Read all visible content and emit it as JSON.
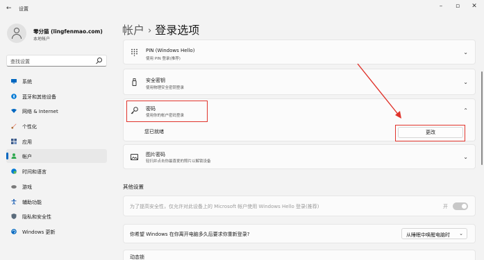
{
  "window": {
    "back_glyph": "←",
    "app_title": "设置",
    "minimize": "–",
    "maximize": "▫",
    "close": "✕"
  },
  "profile": {
    "name": "零分猫 (lingfenmao.com)",
    "account_type": "本地帐户"
  },
  "search": {
    "placeholder": "查找设置"
  },
  "sidebar": {
    "items": [
      {
        "label": "系统",
        "icon": "monitor-icon",
        "color": "#0067c0"
      },
      {
        "label": "蓝牙和其他设备",
        "icon": "bluetooth-icon",
        "color": "#0078d4"
      },
      {
        "label": "网络 & Internet",
        "icon": "wifi-icon",
        "color": "#0067c0"
      },
      {
        "label": "个性化",
        "icon": "brush-icon",
        "color": "#e4745a"
      },
      {
        "label": "应用",
        "icon": "apps-icon",
        "color": "#3b5a8a"
      },
      {
        "label": "帐户",
        "icon": "person-icon",
        "color": "#2fa84f",
        "active": true
      },
      {
        "label": "时间和语言",
        "icon": "globe-clock-icon",
        "color": "#0078d4"
      },
      {
        "label": "游戏",
        "icon": "gamepad-icon",
        "color": "#7a7a7a"
      },
      {
        "label": "辅助功能",
        "icon": "accessibility-icon",
        "color": "#1a5fb4"
      },
      {
        "label": "隐私和安全性",
        "icon": "shield-icon",
        "color": "#5a6b7b"
      },
      {
        "label": "Windows 更新",
        "icon": "update-icon",
        "color": "#0067c0"
      }
    ]
  },
  "header": {
    "breadcrumb_parent": "帐户",
    "separator": "›",
    "title": "登录选项"
  },
  "cards": [
    {
      "title": "PIN (Windows Hello)",
      "subtitle": "使用 PIN 登录(推荐)",
      "icon": "keypad-icon",
      "chevron": "⌄"
    },
    {
      "title": "安全密钥",
      "subtitle": "使用物理安全密钥登录",
      "icon": "usb-key-icon",
      "chevron": "⌄"
    },
    {
      "title": "密码",
      "subtitle": "使用你的帐户密码登录",
      "icon": "key-icon",
      "chevron": "⌃",
      "expanded_text": "您已就绪",
      "button_label": "更改"
    },
    {
      "title": "图片密码",
      "subtitle": "轻扫并点击你最喜爱的照片以解锁设备",
      "icon": "picture-icon",
      "chevron": "⌄"
    }
  ],
  "other_settings": {
    "label": "其他设置",
    "hello_only": {
      "text": "为了提高安全性，仅允许对此设备上的 Microsoft 帐户使用 Windows Hello 登录(推荐)",
      "toggle_label": "开",
      "toggle_on": true
    },
    "require_signin": {
      "text": "你希望 Windows 在你离开电脑多久后要求你重新登录?",
      "dropdown_value": "从睡眠中唤醒电脑时",
      "dropdown_chevron": "⌄"
    },
    "dynamic_lock": {
      "text": "动态锁"
    }
  },
  "annotations": {
    "color": "#e0332b"
  }
}
